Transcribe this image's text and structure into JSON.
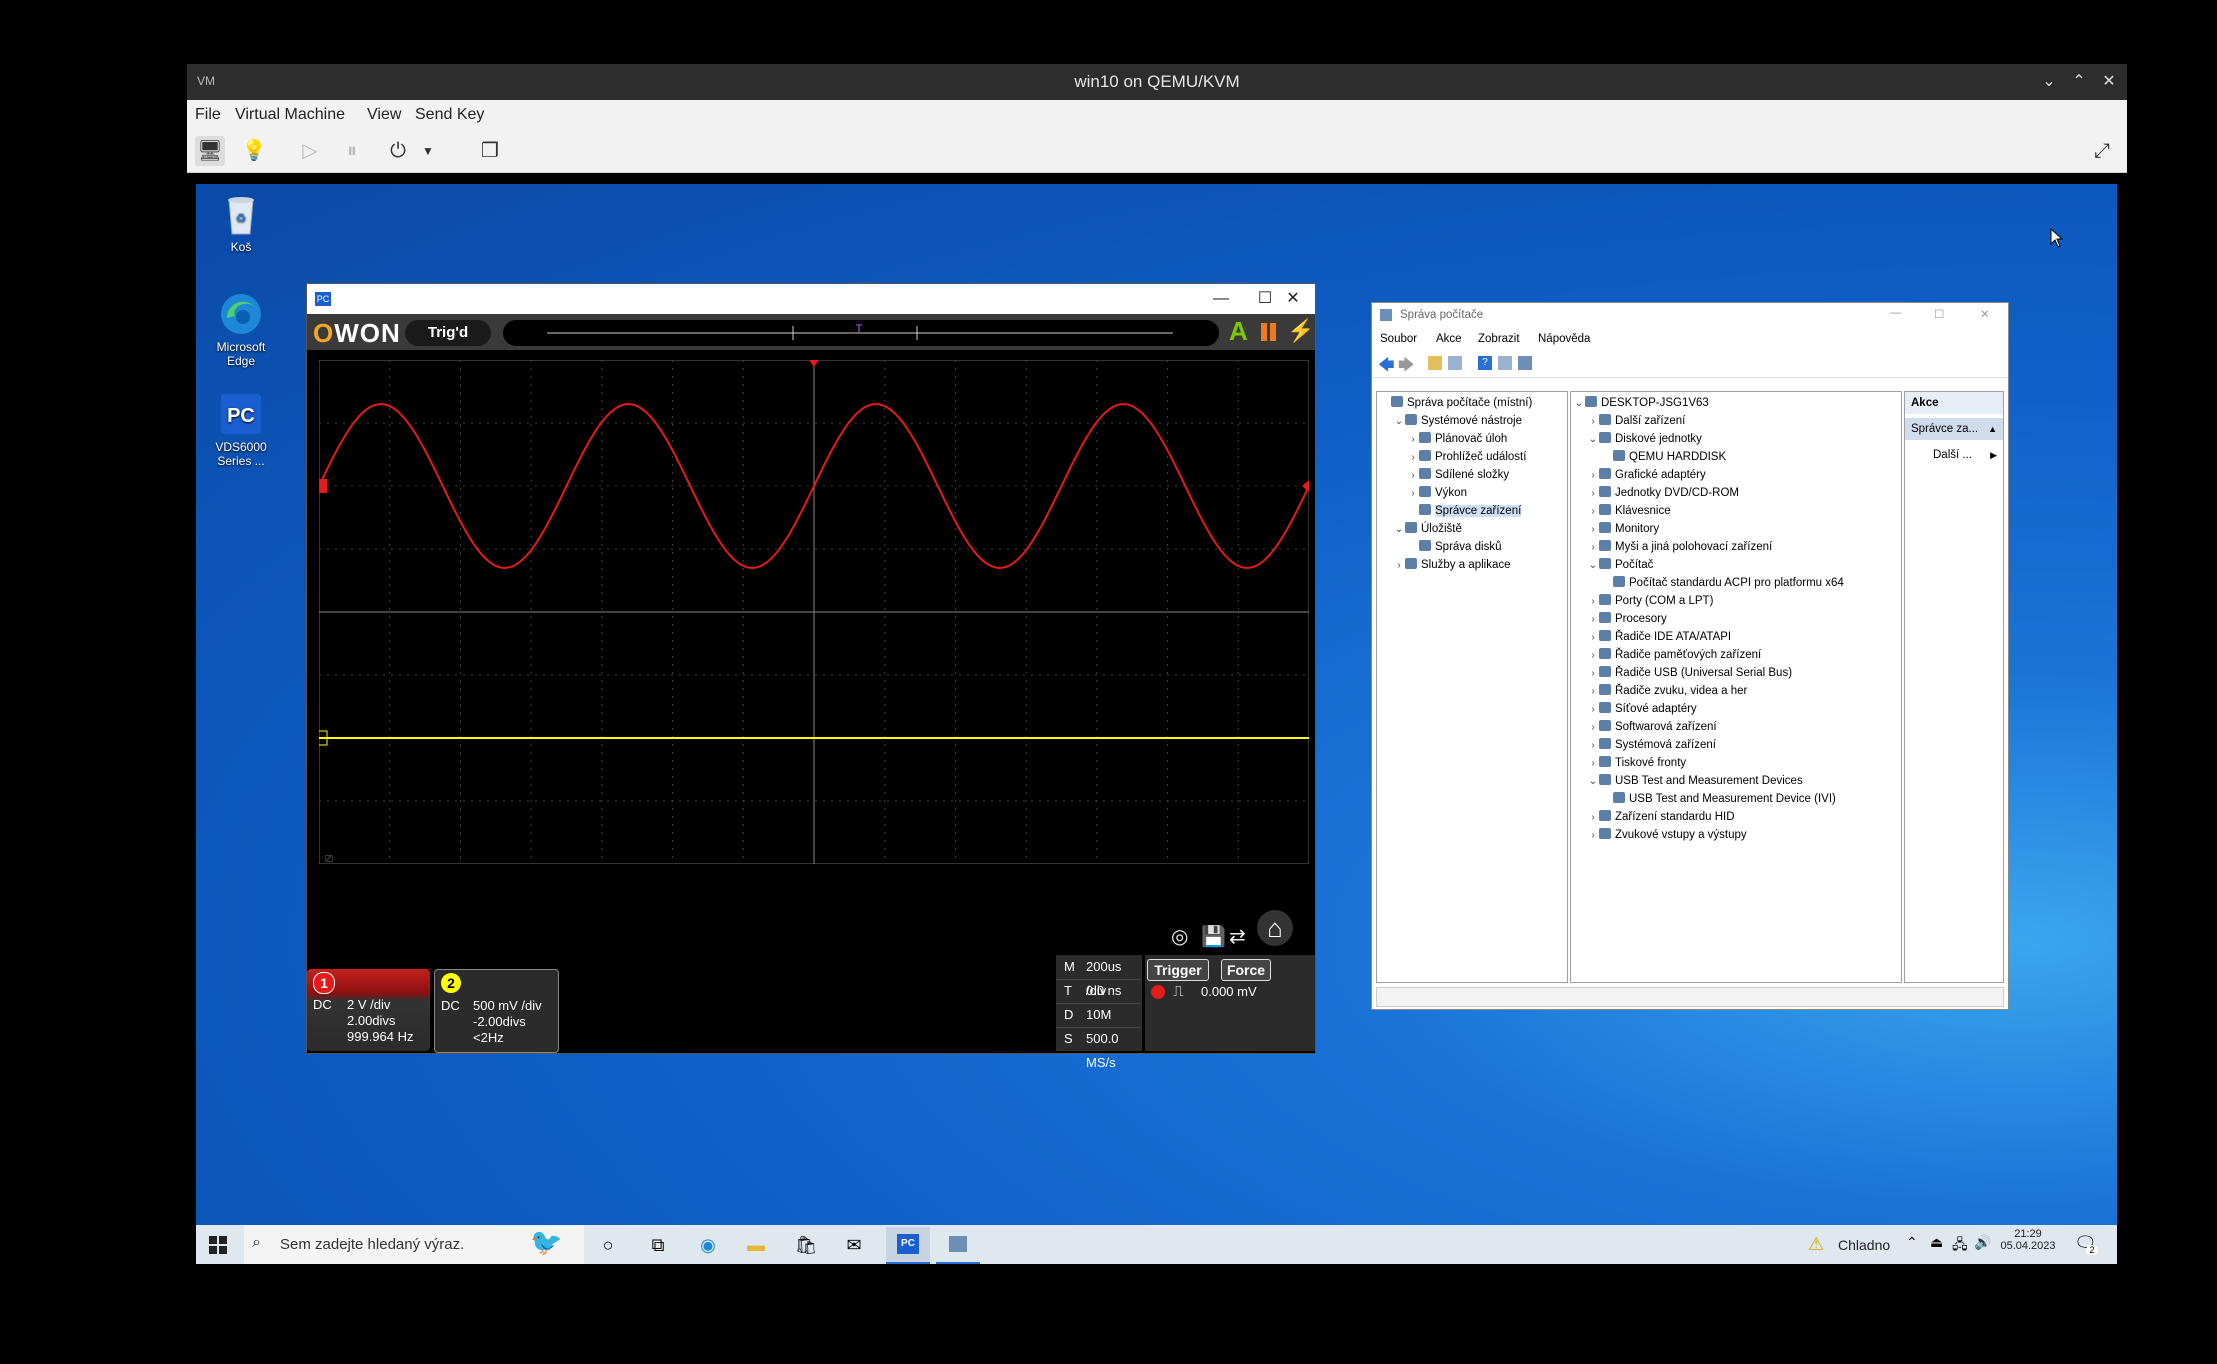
{
  "host": {
    "title": "win10 on QEMU/KVM",
    "logo_text": "VM",
    "menu": [
      "File",
      "Virtual Machine",
      "View",
      "Send Key"
    ],
    "controls": {
      "minimize": "⌄",
      "maximize": "⌃",
      "close": "✕"
    }
  },
  "desktop": {
    "icons": [
      {
        "label": "Koš",
        "icon": "recycle-bin-icon"
      },
      {
        "label": "Microsoft Edge",
        "icon": "edge-icon"
      },
      {
        "label": "VDS6000 Series ...",
        "icon": "pc-app-icon"
      }
    ]
  },
  "osc": {
    "app_icon_text": "PC",
    "logo_prefix": "O",
    "logo_rest": "WON",
    "trig_status": "Trig'd",
    "ch1": {
      "num": "1",
      "coupling": "DC",
      "volts": "2 V /div",
      "offset": "2.00divs",
      "freq": "999.964 Hz",
      "color": "#e41b1b"
    },
    "ch2": {
      "num": "2",
      "coupling": "DC",
      "volts": "500 mV /div",
      "offset": "-2.00divs",
      "freq": "<2Hz",
      "color": "#ffff00"
    },
    "timebase": [
      {
        "key": "M",
        "value": "200us /div"
      },
      {
        "key": "T",
        "value": "0.0 ns"
      },
      {
        "key": "D",
        "value": "10M"
      },
      {
        "key": "S",
        "value": "500.0 MS/s"
      }
    ],
    "trigger_label": "Trigger",
    "force_label": "Force",
    "trigger_level": "0.000 mV",
    "screen_marker": "⎚"
  },
  "cm": {
    "title": "Správa počítače",
    "menu": [
      "Soubor",
      "Akce",
      "Zobrazit",
      "Nápověda"
    ],
    "left_tree": [
      {
        "label": "Správa počítače (místní)",
        "indent": 0,
        "tri": ""
      },
      {
        "label": "Systémové nástroje",
        "indent": 1,
        "tri": "v"
      },
      {
        "label": "Plánovač úloh",
        "indent": 2,
        "tri": ">"
      },
      {
        "label": "Prohlížeč událostí",
        "indent": 2,
        "tri": ">"
      },
      {
        "label": "Sdílené složky",
        "indent": 2,
        "tri": ">"
      },
      {
        "label": "Výkon",
        "indent": 2,
        "tri": ">"
      },
      {
        "label": "Správce zařízení",
        "indent": 2,
        "tri": ""
      },
      {
        "label": "Úložiště",
        "indent": 1,
        "tri": "v"
      },
      {
        "label": "Správa disků",
        "indent": 2,
        "tri": ""
      },
      {
        "label": "Služby a aplikace",
        "indent": 1,
        "tri": ">"
      }
    ],
    "device_tree": [
      {
        "label": "DESKTOP-JSG1V63",
        "indent": 0,
        "tri": "v"
      },
      {
        "label": "Další zařízení",
        "indent": 1,
        "tri": ">"
      },
      {
        "label": "Diskové jednotky",
        "indent": 1,
        "tri": "v"
      },
      {
        "label": "QEMU HARDDISK",
        "indent": 2,
        "tri": ""
      },
      {
        "label": "Grafické adaptéry",
        "indent": 1,
        "tri": ">"
      },
      {
        "label": "Jednotky DVD/CD-ROM",
        "indent": 1,
        "tri": ">"
      },
      {
        "label": "Klávesnice",
        "indent": 1,
        "tri": ">"
      },
      {
        "label": "Monitory",
        "indent": 1,
        "tri": ">"
      },
      {
        "label": "Myši a jiná polohovací zařízení",
        "indent": 1,
        "tri": ">"
      },
      {
        "label": "Počítač",
        "indent": 1,
        "tri": "v"
      },
      {
        "label": "Počítač standardu ACPI pro platformu x64",
        "indent": 2,
        "tri": ""
      },
      {
        "label": "Porty (COM a LPT)",
        "indent": 1,
        "tri": ">"
      },
      {
        "label": "Procesory",
        "indent": 1,
        "tri": ">"
      },
      {
        "label": "Řadiče IDE ATA/ATAPI",
        "indent": 1,
        "tri": ">"
      },
      {
        "label": "Řadiče paměťových zařízení",
        "indent": 1,
        "tri": ">"
      },
      {
        "label": "Řadiče USB (Universal Serial Bus)",
        "indent": 1,
        "tri": ">"
      },
      {
        "label": "Řadiče zvuku, videa a her",
        "indent": 1,
        "tri": ">"
      },
      {
        "label": "Síťové adaptéry",
        "indent": 1,
        "tri": ">"
      },
      {
        "label": "Softwarová zařízení",
        "indent": 1,
        "tri": ">"
      },
      {
        "label": "Systémová zařízení",
        "indent": 1,
        "tri": ">"
      },
      {
        "label": "Tiskové fronty",
        "indent": 1,
        "tri": ">"
      },
      {
        "label": "USB Test and Measurement Devices",
        "indent": 1,
        "tri": "v"
      },
      {
        "label": "USB Test and Measurement Device (IVI)",
        "indent": 2,
        "tri": ""
      },
      {
        "label": "Zařízení standardu HID",
        "indent": 1,
        "tri": ">"
      },
      {
        "label": "Zvukové vstupy a výstupy",
        "indent": 1,
        "tri": ">"
      }
    ],
    "actions_header": "Akce",
    "actions_selected": "Správce za...",
    "actions_more": "Další ..."
  },
  "taskbar": {
    "search_placeholder": "Sem zadejte hledaný výraz.",
    "weather": "Chladno",
    "time": "21:29",
    "date": "05.04.2023",
    "notif_count": "2"
  }
}
